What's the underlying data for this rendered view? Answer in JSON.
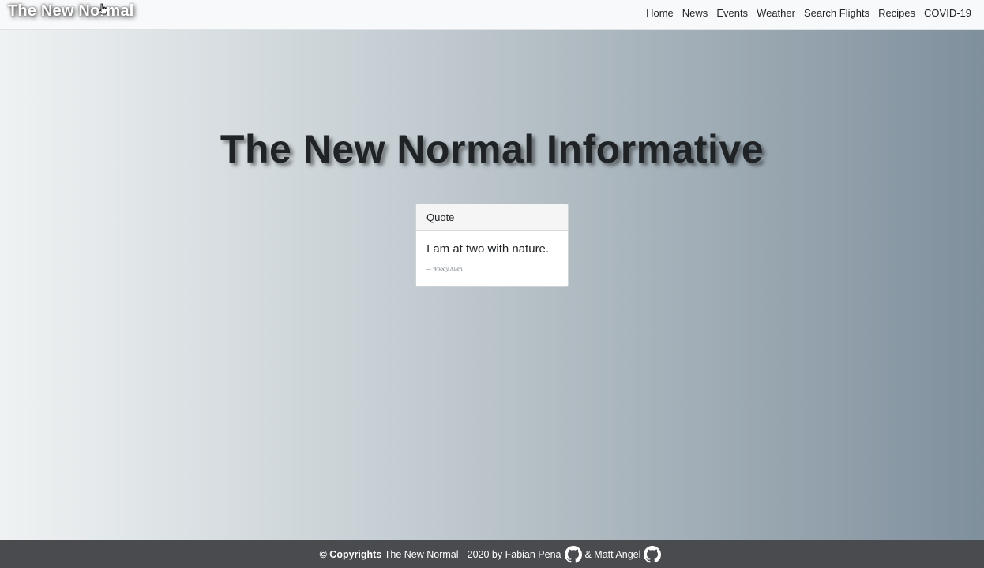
{
  "navbar": {
    "brand": "The New Normal",
    "links": [
      "Home",
      "News",
      "Events",
      "Weather",
      "Search Flights",
      "Recipes",
      "COVID-19"
    ]
  },
  "hero": {
    "title": "The New Normal Informative"
  },
  "quote_card": {
    "header": "Quote",
    "text": "I am at two with nature.",
    "author": "— Woody Allen"
  },
  "footer": {
    "copyright_label": "© Copyrights",
    "text_before": "The New Normal - 2020 by Fabian Pena",
    "text_middle": "& Matt Angel",
    "icon": "github-icon"
  },
  "colors": {
    "navbar_bg": "#f8f9fa",
    "footer_bg": "#4a4b4f",
    "gradient_start": "#eff2f3",
    "gradient_end": "#7f909d"
  }
}
